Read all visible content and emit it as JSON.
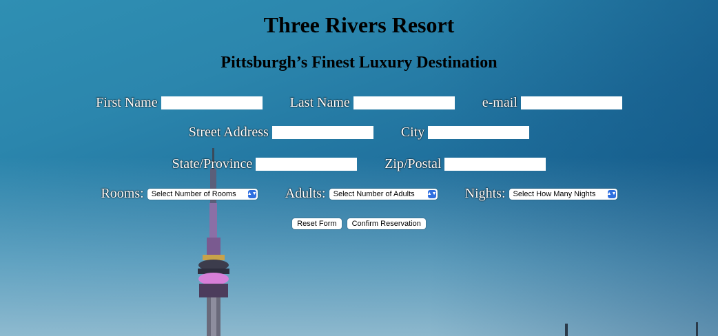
{
  "header": {
    "title": "Three Rivers Resort",
    "subtitle": "Pittsburgh’s Finest Luxury Destination"
  },
  "form": {
    "first_name_label": "First Name",
    "last_name_label": "Last Name",
    "email_label": "e-mail",
    "street_label": "Street Address",
    "city_label": "City",
    "state_label": "State/Province",
    "zip_label": "Zip/Postal",
    "rooms_label": "Rooms:",
    "rooms_selected": "Select Number of Rooms",
    "adults_label": "Adults:",
    "adults_selected": "Select Number of Adults",
    "nights_label": "Nights:",
    "nights_selected": "Select How Many Nights",
    "reset_label": "Reset Form",
    "confirm_label": "Confirm Reservation"
  },
  "icons": {
    "select_arrow": "chevron-up-down-icon"
  },
  "colors": {
    "sky_top": "#2f8fb3",
    "sky_bottom": "#145c8a",
    "select_arrow_accent": "#2f6fe0"
  }
}
